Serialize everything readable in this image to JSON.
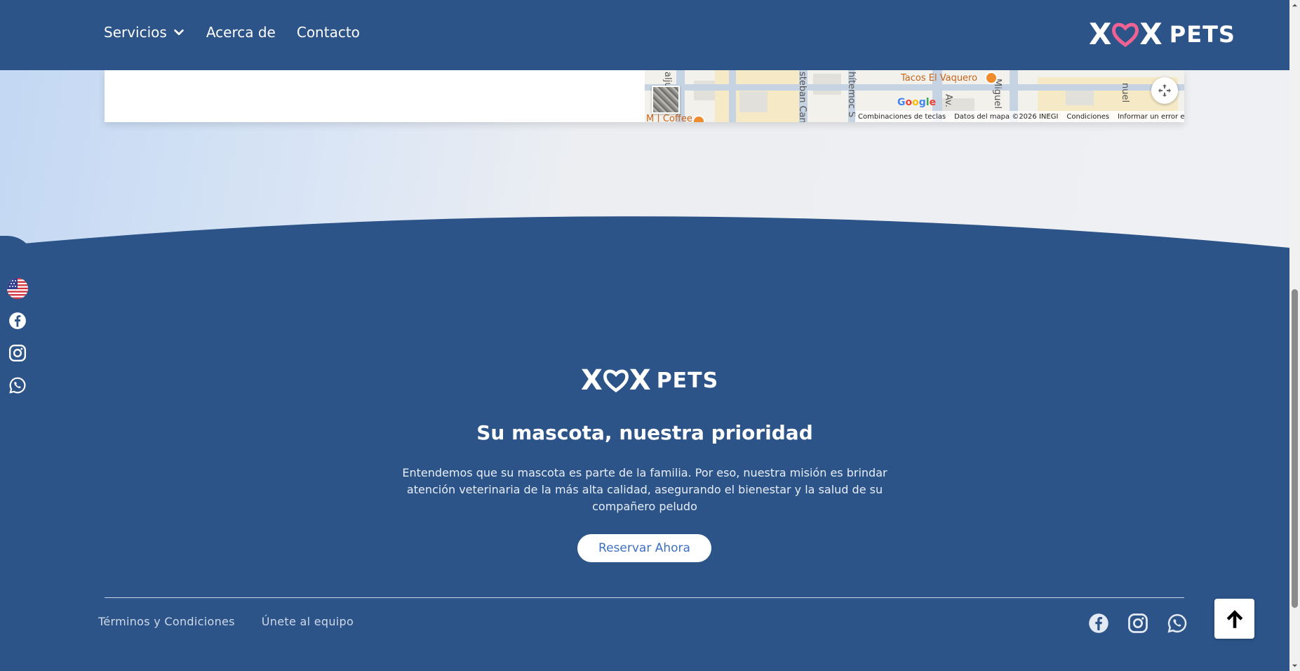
{
  "brand": {
    "logo_mark": "X X",
    "logo_left": "X",
    "logo_right": "X",
    "logo_word": "PETS",
    "heart_color": "#f06292",
    "primary_color": "#2c5489"
  },
  "nav": {
    "items": [
      {
        "label": "Servicios",
        "has_dropdown": true
      },
      {
        "label": "Acerca de"
      },
      {
        "label": "Contacto"
      }
    ]
  },
  "map": {
    "poi_1": "Tacos El Vaquero",
    "poi_2": "M | Coffee",
    "street_1": "aljuto",
    "street_2": "steban Can",
    "street_3": "hítemoc S",
    "street_4": "Av.",
    "street_5": "Miguel",
    "street_6": "nuel",
    "google": "Google",
    "attribution": {
      "shortcuts": "Combinaciones de teclas",
      "data": "Datos del mapa ©2026 INEGI",
      "terms": "Condiciones",
      "report": "Informar un error en el mapa"
    }
  },
  "footer": {
    "tagline": "Su mascota, nuestra prioridad",
    "description": "Entendemos que su mascota es parte de la familia. Por eso, nuestra misión es brindar atención veterinaria de la más alta calidad, asegurando el bienestar y la salud de su compañero peludo",
    "cta_label": "Reservar Ahora",
    "links": [
      {
        "label": "Términos y Condiciones"
      },
      {
        "label": "Únete al equipo"
      }
    ]
  },
  "icons": {
    "language": "us-flag-icon",
    "facebook": "facebook-icon",
    "instagram": "instagram-icon",
    "whatsapp": "whatsapp-icon",
    "back_to_top": "arrow-up-icon",
    "fullscreen": "fullscreen-icon",
    "dropdown": "chevron-down-icon"
  }
}
